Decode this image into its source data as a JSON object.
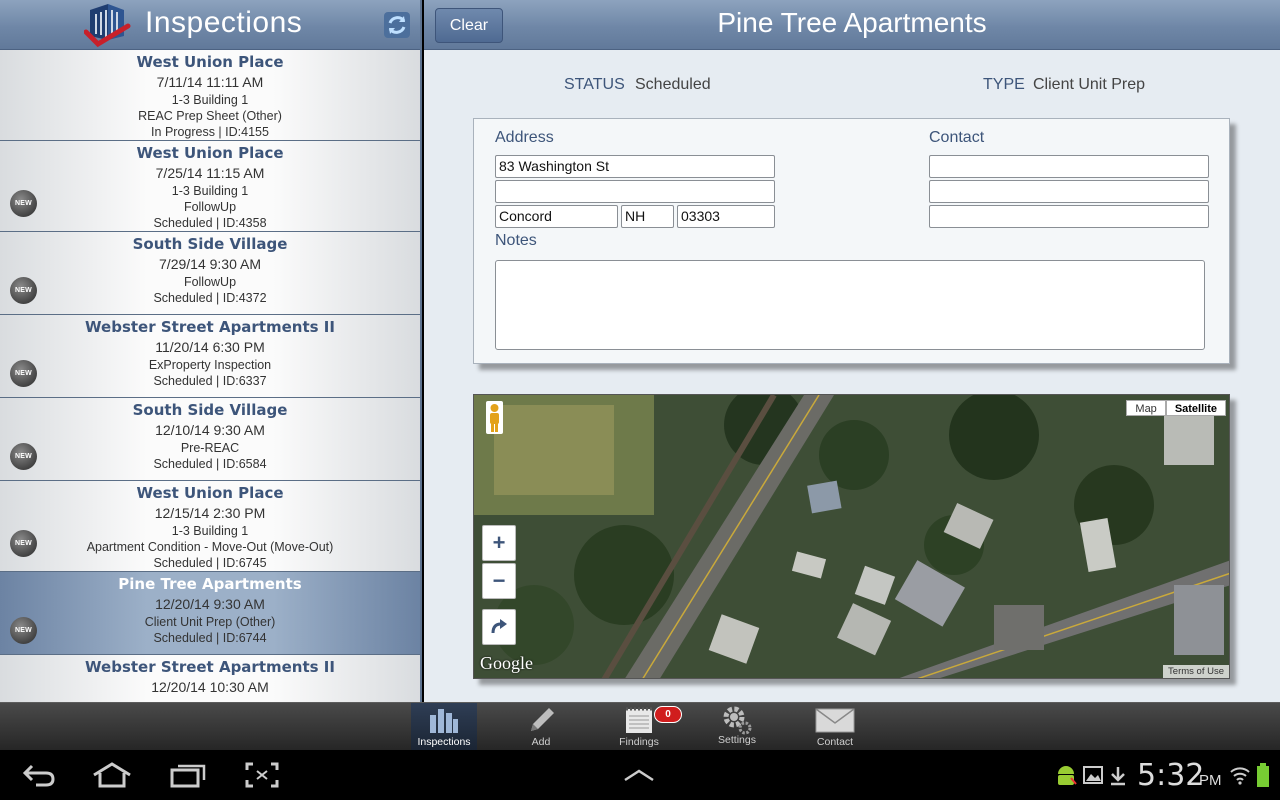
{
  "left": {
    "title": "Inspections",
    "items": [
      {
        "name": "West Union Place",
        "date": "7/11/14 11:11 AM",
        "lines": [
          "1-3 Building 1",
          "REAC Prep Sheet (Other)",
          "In Progress | ID:4155"
        ],
        "new": false,
        "selected": false
      },
      {
        "name": "West Union Place",
        "date": "7/25/14 11:15 AM",
        "lines": [
          "1-3 Building 1",
          "FollowUp",
          "Scheduled | ID:4358"
        ],
        "new": true,
        "selected": false
      },
      {
        "name": "South Side Village",
        "date": "7/29/14 9:30 AM",
        "lines": [
          "FollowUp",
          "Scheduled | ID:4372"
        ],
        "new": true,
        "selected": false
      },
      {
        "name": "Webster Street Apartments II",
        "date": "11/20/14 6:30 PM",
        "lines": [
          "ExProperty Inspection",
          "Scheduled | ID:6337"
        ],
        "new": true,
        "selected": false
      },
      {
        "name": "South Side Village",
        "date": "12/10/14 9:30 AM",
        "lines": [
          "Pre-REAC",
          "Scheduled | ID:6584"
        ],
        "new": true,
        "selected": false
      },
      {
        "name": "West Union Place",
        "date": "12/15/14 2:30 PM",
        "lines": [
          "1-3 Building 1",
          "Apartment Condition - Move-Out (Move-Out)",
          "Scheduled | ID:6745"
        ],
        "new": true,
        "selected": false
      },
      {
        "name": "Pine Tree Apartments",
        "date": "12/20/14 9:30 AM",
        "lines": [
          "Client Unit Prep (Other)",
          "Scheduled | ID:6744"
        ],
        "new": true,
        "selected": true
      },
      {
        "name": "Webster Street Apartments II",
        "date": "12/20/14 10:30 AM",
        "lines": [],
        "new": false,
        "selected": false
      }
    ],
    "new_badge": "NEW"
  },
  "right": {
    "clear_label": "Clear",
    "title": "Pine Tree Apartments",
    "status_label": "STATUS",
    "status_value": "Scheduled",
    "type_label": "TYPE",
    "type_value": "Client Unit Prep",
    "address_label": "Address",
    "address_line1": "83 Washington St",
    "address_line2": "",
    "city": "Concord",
    "state": "NH",
    "zip": "03303",
    "contact_label": "Contact",
    "contact_line1": "",
    "contact_line2": "",
    "contact_line3": "",
    "notes_label": "Notes",
    "notes": ""
  },
  "map": {
    "type_map": "Map",
    "type_satellite": "Satellite",
    "google": "Google",
    "terms": "Terms of Use",
    "zoom_in": "+",
    "zoom_out": "−"
  },
  "tabs": [
    {
      "label": "Inspections",
      "active": true
    },
    {
      "label": "Add",
      "active": false
    },
    {
      "label": "Findings",
      "active": false,
      "badge": "0"
    },
    {
      "label": "Settings",
      "active": false
    },
    {
      "label": "Contact",
      "active": false
    }
  ],
  "system": {
    "time": "5:32",
    "ampm": "PM"
  },
  "colors": {
    "header_blue": "#6f87a7",
    "title_blue": "#3d557a",
    "badge_red": "#d01d1d"
  }
}
